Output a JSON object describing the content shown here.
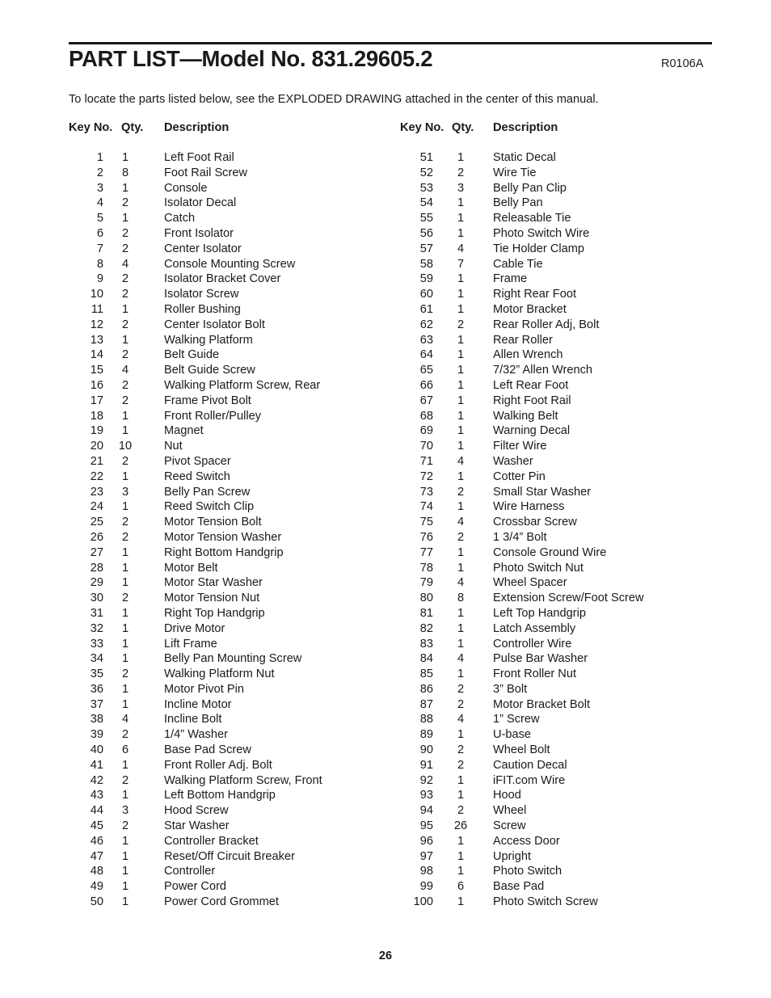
{
  "document": {
    "title": "PART LIST—Model No. 831.29605.2",
    "revision_code": "R0106A",
    "intro": "To locate the parts listed below, see the EXPLODED DRAWING attached in the center of this manual.",
    "page_number": "26"
  },
  "table": {
    "headers": {
      "key_no": "Key No.",
      "qty": "Qty.",
      "description": "Description"
    },
    "left_column": [
      {
        "key": "1",
        "qty": "1",
        "desc": "Left Foot Rail"
      },
      {
        "key": "2",
        "qty": "8",
        "desc": "Foot Rail Screw"
      },
      {
        "key": "3",
        "qty": "1",
        "desc": "Console"
      },
      {
        "key": "4",
        "qty": "2",
        "desc": "Isolator Decal"
      },
      {
        "key": "5",
        "qty": "1",
        "desc": "Catch"
      },
      {
        "key": "6",
        "qty": "2",
        "desc": "Front Isolator"
      },
      {
        "key": "7",
        "qty": "2",
        "desc": "Center Isolator"
      },
      {
        "key": "8",
        "qty": "4",
        "desc": "Console Mounting Screw"
      },
      {
        "key": "9",
        "qty": "2",
        "desc": "Isolator Bracket Cover"
      },
      {
        "key": "10",
        "qty": "2",
        "desc": "Isolator Screw"
      },
      {
        "key": "11",
        "qty": "1",
        "desc": "Roller Bushing"
      },
      {
        "key": "12",
        "qty": "2",
        "desc": "Center Isolator Bolt"
      },
      {
        "key": "13",
        "qty": "1",
        "desc": "Walking Platform"
      },
      {
        "key": "14",
        "qty": "2",
        "desc": "Belt Guide"
      },
      {
        "key": "15",
        "qty": "4",
        "desc": "Belt Guide Screw"
      },
      {
        "key": "16",
        "qty": "2",
        "desc": "Walking Platform Screw, Rear"
      },
      {
        "key": "17",
        "qty": "2",
        "desc": "Frame Pivot Bolt"
      },
      {
        "key": "18",
        "qty": "1",
        "desc": "Front Roller/Pulley"
      },
      {
        "key": "19",
        "qty": "1",
        "desc": "Magnet"
      },
      {
        "key": "20",
        "qty": "10",
        "desc": "Nut"
      },
      {
        "key": "21",
        "qty": "2",
        "desc": "Pivot Spacer"
      },
      {
        "key": "22",
        "qty": "1",
        "desc": "Reed Switch"
      },
      {
        "key": "23",
        "qty": "3",
        "desc": "Belly Pan Screw"
      },
      {
        "key": "24",
        "qty": "1",
        "desc": "Reed Switch Clip"
      },
      {
        "key": "25",
        "qty": "2",
        "desc": "Motor Tension Bolt"
      },
      {
        "key": "26",
        "qty": "2",
        "desc": "Motor Tension Washer"
      },
      {
        "key": "27",
        "qty": "1",
        "desc": "Right Bottom Handgrip"
      },
      {
        "key": "28",
        "qty": "1",
        "desc": "Motor Belt"
      },
      {
        "key": "29",
        "qty": "1",
        "desc": "Motor Star Washer"
      },
      {
        "key": "30",
        "qty": "2",
        "desc": "Motor Tension Nut"
      },
      {
        "key": "31",
        "qty": "1",
        "desc": "Right Top Handgrip"
      },
      {
        "key": "32",
        "qty": "1",
        "desc": "Drive Motor"
      },
      {
        "key": "33",
        "qty": "1",
        "desc": "Lift Frame"
      },
      {
        "key": "34",
        "qty": "1",
        "desc": "Belly Pan Mounting Screw"
      },
      {
        "key": "35",
        "qty": "2",
        "desc": "Walking Platform Nut"
      },
      {
        "key": "36",
        "qty": "1",
        "desc": "Motor Pivot Pin"
      },
      {
        "key": "37",
        "qty": "1",
        "desc": "Incline Motor"
      },
      {
        "key": "38",
        "qty": "4",
        "desc": "Incline Bolt"
      },
      {
        "key": "39",
        "qty": "2",
        "desc": "1/4” Washer"
      },
      {
        "key": "40",
        "qty": "6",
        "desc": "Base Pad Screw"
      },
      {
        "key": "41",
        "qty": "1",
        "desc": "Front Roller Adj. Bolt"
      },
      {
        "key": "42",
        "qty": "2",
        "desc": "Walking Platform Screw, Front"
      },
      {
        "key": "43",
        "qty": "1",
        "desc": "Left Bottom Handgrip"
      },
      {
        "key": "44",
        "qty": "3",
        "desc": "Hood Screw"
      },
      {
        "key": "45",
        "qty": "2",
        "desc": "Star Washer"
      },
      {
        "key": "46",
        "qty": "1",
        "desc": "Controller Bracket"
      },
      {
        "key": "47",
        "qty": "1",
        "desc": "Reset/Off Circuit Breaker"
      },
      {
        "key": "48",
        "qty": "1",
        "desc": "Controller"
      },
      {
        "key": "49",
        "qty": "1",
        "desc": "Power Cord"
      },
      {
        "key": "50",
        "qty": "1",
        "desc": "Power Cord Grommet"
      }
    ],
    "right_column": [
      {
        "key": "51",
        "qty": "1",
        "desc": "Static Decal"
      },
      {
        "key": "52",
        "qty": "2",
        "desc": "Wire Tie"
      },
      {
        "key": "53",
        "qty": "3",
        "desc": "Belly Pan Clip"
      },
      {
        "key": "54",
        "qty": "1",
        "desc": "Belly Pan"
      },
      {
        "key": "55",
        "qty": "1",
        "desc": "Releasable Tie"
      },
      {
        "key": "56",
        "qty": "1",
        "desc": "Photo Switch Wire"
      },
      {
        "key": "57",
        "qty": "4",
        "desc": "Tie Holder Clamp"
      },
      {
        "key": "58",
        "qty": "7",
        "desc": "Cable Tie"
      },
      {
        "key": "59",
        "qty": "1",
        "desc": "Frame"
      },
      {
        "key": "60",
        "qty": "1",
        "desc": "Right Rear Foot"
      },
      {
        "key": "61",
        "qty": "1",
        "desc": "Motor Bracket"
      },
      {
        "key": "62",
        "qty": "2",
        "desc": "Rear Roller Adj, Bolt"
      },
      {
        "key": "63",
        "qty": "1",
        "desc": "Rear Roller"
      },
      {
        "key": "64",
        "qty": "1",
        "desc": "Allen Wrench"
      },
      {
        "key": "65",
        "qty": "1",
        "desc": "7/32” Allen Wrench"
      },
      {
        "key": "66",
        "qty": "1",
        "desc": "Left Rear Foot"
      },
      {
        "key": "67",
        "qty": "1",
        "desc": "Right Foot Rail"
      },
      {
        "key": "68",
        "qty": "1",
        "desc": "Walking Belt"
      },
      {
        "key": "69",
        "qty": "1",
        "desc": "Warning Decal"
      },
      {
        "key": "70",
        "qty": "1",
        "desc": "Filter Wire"
      },
      {
        "key": "71",
        "qty": "4",
        "desc": "Washer"
      },
      {
        "key": "72",
        "qty": "1",
        "desc": "Cotter Pin"
      },
      {
        "key": "73",
        "qty": "2",
        "desc": "Small Star Washer"
      },
      {
        "key": "74",
        "qty": "1",
        "desc": "Wire Harness"
      },
      {
        "key": "75",
        "qty": "4",
        "desc": "Crossbar Screw"
      },
      {
        "key": "76",
        "qty": "2",
        "desc": "1 3/4” Bolt"
      },
      {
        "key": "77",
        "qty": "1",
        "desc": "Console Ground Wire"
      },
      {
        "key": "78",
        "qty": "1",
        "desc": "Photo Switch Nut"
      },
      {
        "key": "79",
        "qty": "4",
        "desc": "Wheel Spacer"
      },
      {
        "key": "80",
        "qty": "8",
        "desc": "Extension Screw/Foot Screw"
      },
      {
        "key": "81",
        "qty": "1",
        "desc": "Left Top Handgrip"
      },
      {
        "key": "82",
        "qty": "1",
        "desc": "Latch Assembly"
      },
      {
        "key": "83",
        "qty": "1",
        "desc": "Controller Wire"
      },
      {
        "key": "84",
        "qty": "4",
        "desc": "Pulse Bar Washer"
      },
      {
        "key": "85",
        "qty": "1",
        "desc": "Front Roller Nut"
      },
      {
        "key": "86",
        "qty": "2",
        "desc": "3” Bolt"
      },
      {
        "key": "87",
        "qty": "2",
        "desc": "Motor Bracket Bolt"
      },
      {
        "key": "88",
        "qty": "4",
        "desc": "1” Screw"
      },
      {
        "key": "89",
        "qty": "1",
        "desc": "U-base"
      },
      {
        "key": "90",
        "qty": "2",
        "desc": "Wheel Bolt"
      },
      {
        "key": "91",
        "qty": "2",
        "desc": "Caution Decal"
      },
      {
        "key": "92",
        "qty": "1",
        "desc": "iFIT.com Wire"
      },
      {
        "key": "93",
        "qty": "1",
        "desc": "Hood"
      },
      {
        "key": "94",
        "qty": "2",
        "desc": "Wheel"
      },
      {
        "key": "95",
        "qty": "26",
        "desc": "Screw"
      },
      {
        "key": "96",
        "qty": "1",
        "desc": "Access Door"
      },
      {
        "key": "97",
        "qty": "1",
        "desc": "Upright"
      },
      {
        "key": "98",
        "qty": "1",
        "desc": "Photo Switch"
      },
      {
        "key": "99",
        "qty": "6",
        "desc": "Base Pad"
      },
      {
        "key": "100",
        "qty": "1",
        "desc": "Photo Switch Screw"
      }
    ]
  }
}
